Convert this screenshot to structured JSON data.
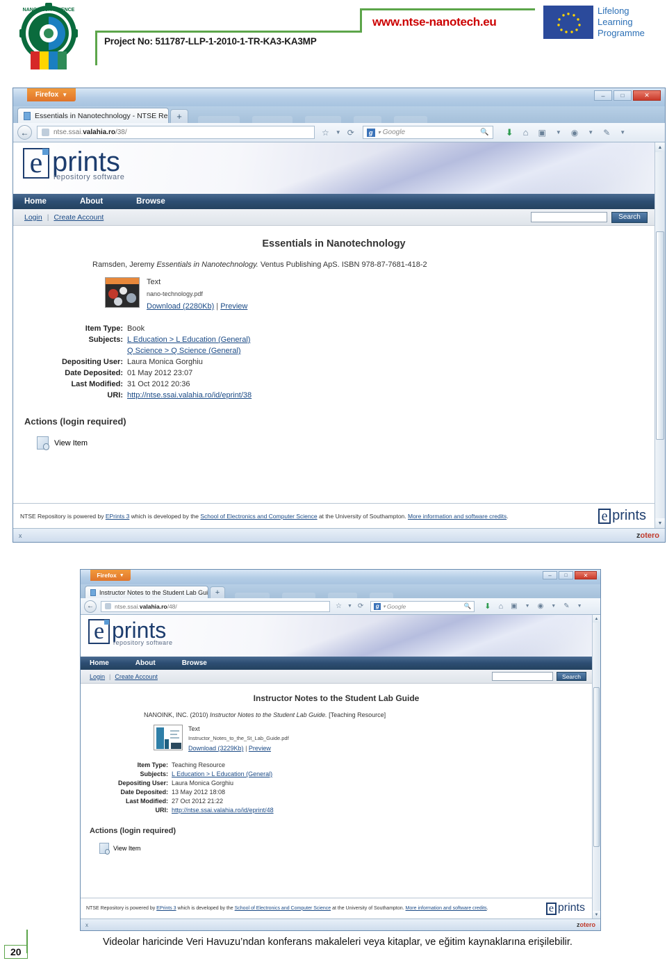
{
  "doc_header": {
    "project_no": "Project No: 511787-LLP-1-2010-1-TR-KA3-KA3MP",
    "site_url": "www.ntse-nanotech.eu",
    "logo_alt": "nano-tech-science-education-logo",
    "llp_line1": "Lifelong",
    "llp_line2": "Learning",
    "llp_line3": "Programme"
  },
  "browser_top": {
    "firefox_menu_label": "Firefox",
    "tab_title": "Essentials in Nanotechnology - NTSE Re..",
    "new_tab_label": "+",
    "url_prefix": "ntse.ssai.",
    "url_domain": "valahia.ro",
    "url_suffix": "/38/",
    "search_engine_placeholder": "Google",
    "window_controls": {
      "minimize": "–",
      "maximize": "□",
      "close": "✕"
    },
    "toolbar_icons": [
      "bookmark-star-icon",
      "chevron-down-icon",
      "reload-icon",
      "search-icon",
      "download-icon",
      "home-icon",
      "library-icon",
      "zotero-icon",
      "tools-icon"
    ],
    "site": {
      "logo_e": "e",
      "logo_word": "prints",
      "logo_sub": "repository software",
      "nav": [
        {
          "label": "Home",
          "name": "nav-home"
        },
        {
          "label": "About",
          "name": "nav-about"
        },
        {
          "label": "Browse",
          "name": "nav-browse"
        }
      ],
      "login_label": "Login",
      "divider": "|",
      "create_account_label": "Create Account",
      "search_value": "",
      "search_button_label": "Search"
    },
    "item": {
      "title": "Essentials in Nanotechnology",
      "citation_author": "Ramsden, Jeremy ",
      "citation_work": "Essentials in Nanotechnology.",
      "citation_tail": " Ventus Publishing ApS. ISBN 978-87-7681-418-2",
      "doc_format": "Text",
      "doc_filename": "nano-technology.pdf",
      "download_label": "Download (2280Kb)",
      "preview_label": "Preview",
      "fields": [
        {
          "label": "Item Type:",
          "value": "Book",
          "links": []
        },
        {
          "label": "Subjects:",
          "value": "",
          "links": [
            "L Education > L Education (General)",
            "Q Science > Q Science (General)"
          ]
        },
        {
          "label": "Depositing User:",
          "value": "Laura Monica Gorghiu",
          "links": []
        },
        {
          "label": "Date Deposited:",
          "value": "01 May 2012 23:07",
          "links": []
        },
        {
          "label": "Last Modified:",
          "value": "31 Oct 2012 20:36",
          "links": []
        },
        {
          "label": "URI:",
          "value": "",
          "links": [
            "http://ntse.ssai.valahia.ro/id/eprint/38"
          ]
        }
      ],
      "actions_title": "Actions (login required)",
      "action_view_item": "View Item"
    },
    "footer": {
      "text_1": "NTSE Repository is powered by ",
      "link_1": "EPrints 3",
      "text_2": " which is developed by the ",
      "link_2": "School of Electronics and Computer Science",
      "text_3": " at the University of Southampton. ",
      "link_3": "More information and software credits",
      "text_4": ".",
      "logo_e": "e",
      "logo_word": "prints"
    },
    "status": {
      "left": "x",
      "zotero_z": "z",
      "zotero_rest": "otero"
    }
  },
  "browser_bottom": {
    "firefox_menu_label": "Firefox",
    "tab_title": "Instructor Notes to the Student Lab Guid..",
    "new_tab_label": "+",
    "url_prefix": "ntse.ssai.",
    "url_domain": "valahia.ro",
    "url_suffix": "/48/",
    "search_engine_placeholder": "Google",
    "window_controls": {
      "minimize": "–",
      "maximize": "□",
      "close": "✕"
    },
    "site": {
      "logo_e": "e",
      "logo_word": "prints",
      "logo_sub": "repository software",
      "nav": [
        {
          "label": "Home",
          "name": "nav-home"
        },
        {
          "label": "About",
          "name": "nav-about"
        },
        {
          "label": "Browse",
          "name": "nav-browse"
        }
      ],
      "login_label": "Login",
      "divider": "|",
      "create_account_label": "Create Account",
      "search_value": "",
      "search_button_label": "Search"
    },
    "item": {
      "title": "Instructor Notes to the Student Lab Guide",
      "citation_author": "NANOINK, INC. (2010) ",
      "citation_work": "Instructor Notes to the Student Lab Guide.",
      "citation_tail": " [Teaching Resource]",
      "doc_format": "Text",
      "doc_filename": "Instructor_Notes_to_the_St_Lab_Guide.pdf",
      "download_label": "Download (3229Kb)",
      "preview_label": "Preview",
      "fields": [
        {
          "label": "Item Type:",
          "value": "Teaching Resource",
          "links": []
        },
        {
          "label": "Subjects:",
          "value": "",
          "links": [
            "L Education > L Education (General)"
          ]
        },
        {
          "label": "Depositing User:",
          "value": "Laura Monica Gorghiu",
          "links": []
        },
        {
          "label": "Date Deposited:",
          "value": "13 May 2012 18:08",
          "links": []
        },
        {
          "label": "Last Modified:",
          "value": "27 Oct 2012 21:22",
          "links": []
        },
        {
          "label": "URI:",
          "value": "",
          "links": [
            "http://ntse.ssai.valahia.ro/id/eprint/48"
          ]
        }
      ],
      "actions_title": "Actions (login required)",
      "action_view_item": "View Item"
    },
    "footer": {
      "text_1": "NTSE Repository is powered by ",
      "link_1": "EPrints 3",
      "text_2": " which is developed by the ",
      "link_2": "School of Electronics and Computer Science",
      "text_3": " at the University of Southampton. ",
      "link_3": "More information and software credits",
      "text_4": ".",
      "logo_e": "e",
      "logo_word": "prints"
    },
    "status": {
      "left": "x",
      "zotero_z": "z",
      "zotero_rest": "otero"
    }
  },
  "caption": {
    "page_number": "20",
    "text": "Videolar haricinde Veri Havuzu’ndan konferans makaleleri veya kitaplar, ve eğitim kaynaklarına erişilebilir."
  },
  "colors": {
    "accent_green": "#5ca54a",
    "url_red": "#cc0000",
    "eprints_blue": "#1d3d6e",
    "link_blue": "#1a4a86",
    "zotero_red": "#c0392b"
  }
}
